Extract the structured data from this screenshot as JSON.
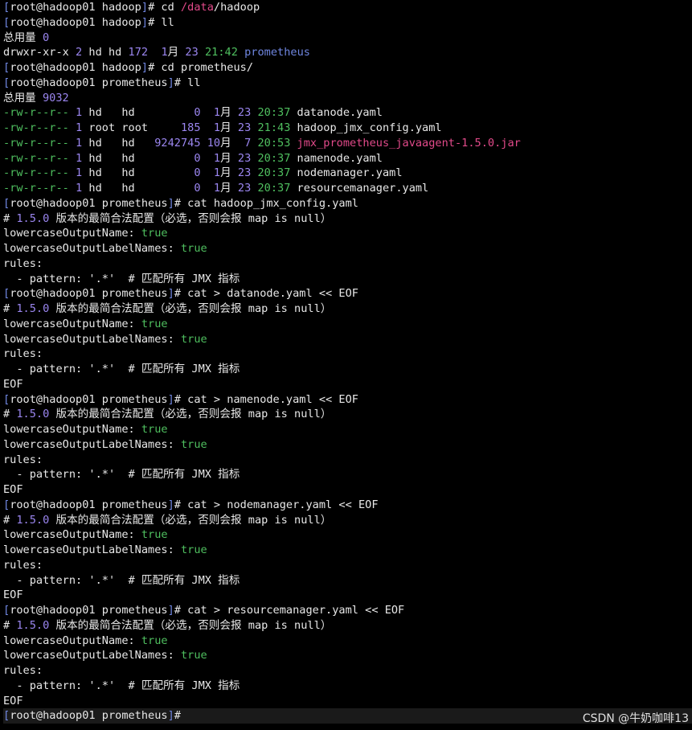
{
  "terminal": {
    "prompt_user_host": "root@hadoop01",
    "lines": [
      [
        {
          "t": "[",
          "c": "bracket"
        },
        {
          "t": "root@hadoop01 hadoop",
          "c": "c-white"
        },
        {
          "t": "]",
          "c": "bracket"
        },
        {
          "t": "# cd ",
          "c": "c-white"
        },
        {
          "t": "/data",
          "c": "c-red"
        },
        {
          "t": "/hadoop",
          "c": "c-white"
        }
      ],
      [
        {
          "t": "[",
          "c": "bracket"
        },
        {
          "t": "root@hadoop01 hadoop",
          "c": "c-white"
        },
        {
          "t": "]",
          "c": "bracket"
        },
        {
          "t": "# ll",
          "c": "c-white"
        }
      ],
      [
        {
          "t": "总用量 ",
          "c": "c-white"
        },
        {
          "t": "0",
          "c": "c-purple"
        }
      ],
      [
        {
          "t": "drwxr-xr-x ",
          "c": "c-white"
        },
        {
          "t": "2",
          "c": "c-purple"
        },
        {
          "t": " hd hd ",
          "c": "c-white"
        },
        {
          "t": "172",
          "c": "c-purple"
        },
        {
          "t": "  ",
          "c": "c-white"
        },
        {
          "t": "1",
          "c": "c-purple"
        },
        {
          "t": "月 ",
          "c": "c-white"
        },
        {
          "t": "23",
          "c": "c-purple"
        },
        {
          "t": " ",
          "c": "c-white"
        },
        {
          "t": "21:42",
          "c": "c-green"
        },
        {
          "t": " prometheus",
          "c": "c-blue"
        }
      ],
      [
        {
          "t": "[",
          "c": "bracket"
        },
        {
          "t": "root@hadoop01 hadoop",
          "c": "c-white"
        },
        {
          "t": "]",
          "c": "bracket"
        },
        {
          "t": "# cd prometheus/",
          "c": "c-white"
        }
      ],
      [
        {
          "t": "[",
          "c": "bracket"
        },
        {
          "t": "root@hadoop01 prometheus",
          "c": "c-white"
        },
        {
          "t": "]",
          "c": "bracket"
        },
        {
          "t": "# ll",
          "c": "c-white"
        }
      ],
      [
        {
          "t": "总用量 ",
          "c": "c-white"
        },
        {
          "t": "9032",
          "c": "c-purple"
        }
      ],
      [
        {
          "t": "-rw-r--r-- ",
          "c": "c-green"
        },
        {
          "t": "1",
          "c": "c-purple"
        },
        {
          "t": " hd   hd         ",
          "c": "c-white"
        },
        {
          "t": "0",
          "c": "c-purple"
        },
        {
          "t": "  ",
          "c": "c-white"
        },
        {
          "t": "1",
          "c": "c-purple"
        },
        {
          "t": "月 ",
          "c": "c-white"
        },
        {
          "t": "23",
          "c": "c-purple"
        },
        {
          "t": " ",
          "c": "c-white"
        },
        {
          "t": "20:37",
          "c": "c-green"
        },
        {
          "t": " datanode.yaml",
          "c": "c-white"
        }
      ],
      [
        {
          "t": "-rw-r--r-- ",
          "c": "c-green"
        },
        {
          "t": "1",
          "c": "c-purple"
        },
        {
          "t": " root root     ",
          "c": "c-white"
        },
        {
          "t": "185",
          "c": "c-purple"
        },
        {
          "t": "  ",
          "c": "c-white"
        },
        {
          "t": "1",
          "c": "c-purple"
        },
        {
          "t": "月 ",
          "c": "c-white"
        },
        {
          "t": "23",
          "c": "c-purple"
        },
        {
          "t": " ",
          "c": "c-white"
        },
        {
          "t": "21:43",
          "c": "c-green"
        },
        {
          "t": " hadoop_jmx_config.yaml",
          "c": "c-white"
        }
      ],
      [
        {
          "t": "-rw-r--r-- ",
          "c": "c-green"
        },
        {
          "t": "1",
          "c": "c-purple"
        },
        {
          "t": " hd   hd   ",
          "c": "c-white"
        },
        {
          "t": "9242745",
          "c": "c-purple"
        },
        {
          "t": " ",
          "c": "c-white"
        },
        {
          "t": "10",
          "c": "c-purple"
        },
        {
          "t": "月  ",
          "c": "c-white"
        },
        {
          "t": "7",
          "c": "c-purple"
        },
        {
          "t": " ",
          "c": "c-white"
        },
        {
          "t": "20:53",
          "c": "c-green"
        },
        {
          "t": " jmx_prometheus_javaagent-1.5.0.jar",
          "c": "c-red"
        }
      ],
      [
        {
          "t": "-rw-r--r-- ",
          "c": "c-green"
        },
        {
          "t": "1",
          "c": "c-purple"
        },
        {
          "t": " hd   hd         ",
          "c": "c-white"
        },
        {
          "t": "0",
          "c": "c-purple"
        },
        {
          "t": "  ",
          "c": "c-white"
        },
        {
          "t": "1",
          "c": "c-purple"
        },
        {
          "t": "月 ",
          "c": "c-white"
        },
        {
          "t": "23",
          "c": "c-purple"
        },
        {
          "t": " ",
          "c": "c-white"
        },
        {
          "t": "20:37",
          "c": "c-green"
        },
        {
          "t": " namenode.yaml",
          "c": "c-white"
        }
      ],
      [
        {
          "t": "-rw-r--r-- ",
          "c": "c-green"
        },
        {
          "t": "1",
          "c": "c-purple"
        },
        {
          "t": " hd   hd         ",
          "c": "c-white"
        },
        {
          "t": "0",
          "c": "c-purple"
        },
        {
          "t": "  ",
          "c": "c-white"
        },
        {
          "t": "1",
          "c": "c-purple"
        },
        {
          "t": "月 ",
          "c": "c-white"
        },
        {
          "t": "23",
          "c": "c-purple"
        },
        {
          "t": " ",
          "c": "c-white"
        },
        {
          "t": "20:37",
          "c": "c-green"
        },
        {
          "t": " nodemanager.yaml",
          "c": "c-white"
        }
      ],
      [
        {
          "t": "-rw-r--r-- ",
          "c": "c-green"
        },
        {
          "t": "1",
          "c": "c-purple"
        },
        {
          "t": " hd   hd         ",
          "c": "c-white"
        },
        {
          "t": "0",
          "c": "c-purple"
        },
        {
          "t": "  ",
          "c": "c-white"
        },
        {
          "t": "1",
          "c": "c-purple"
        },
        {
          "t": "月 ",
          "c": "c-white"
        },
        {
          "t": "23",
          "c": "c-purple"
        },
        {
          "t": " ",
          "c": "c-white"
        },
        {
          "t": "20:37",
          "c": "c-green"
        },
        {
          "t": " resourcemanager.yaml",
          "c": "c-white"
        }
      ],
      [
        {
          "t": "[",
          "c": "bracket"
        },
        {
          "t": "root@hadoop01 prometheus",
          "c": "c-white"
        },
        {
          "t": "]",
          "c": "bracket"
        },
        {
          "t": "# cat hadoop_jmx_config.yaml",
          "c": "c-white"
        }
      ],
      [
        {
          "t": "# ",
          "c": "c-white"
        },
        {
          "t": "1.5.0",
          "c": "c-purple"
        },
        {
          "t": " 版本的最简合法配置（必选，否则会报 map is null）",
          "c": "c-white"
        }
      ],
      [
        {
          "t": "lowercaseOutputName",
          "c": "c-white"
        },
        {
          "t": ": ",
          "c": "c-white"
        },
        {
          "t": "true",
          "c": "c-green"
        }
      ],
      [
        {
          "t": "lowercaseOutputLabelNames",
          "c": "c-white"
        },
        {
          "t": ": ",
          "c": "c-white"
        },
        {
          "t": "true",
          "c": "c-green"
        }
      ],
      [
        {
          "t": "rules:",
          "c": "c-white"
        }
      ],
      [
        {
          "t": "  - pattern: '.*'  # 匹配所有 JMX 指标",
          "c": "c-white"
        }
      ],
      [
        {
          "t": "[",
          "c": "bracket"
        },
        {
          "t": "root@hadoop01 prometheus",
          "c": "c-white"
        },
        {
          "t": "]",
          "c": "bracket"
        },
        {
          "t": "# cat > datanode.yaml << EOF",
          "c": "c-white"
        }
      ],
      [
        {
          "t": "# ",
          "c": "c-white"
        },
        {
          "t": "1.5.0",
          "c": "c-purple"
        },
        {
          "t": " 版本的最简合法配置（必选，否则会报 map is null）",
          "c": "c-white"
        }
      ],
      [
        {
          "t": "lowercaseOutputName",
          "c": "c-white"
        },
        {
          "t": ": ",
          "c": "c-white"
        },
        {
          "t": "true",
          "c": "c-green"
        }
      ],
      [
        {
          "t": "lowercaseOutputLabelNames",
          "c": "c-white"
        },
        {
          "t": ": ",
          "c": "c-white"
        },
        {
          "t": "true",
          "c": "c-green"
        }
      ],
      [
        {
          "t": "rules:",
          "c": "c-white"
        }
      ],
      [
        {
          "t": "  - pattern: '.*'  # 匹配所有 JMX 指标",
          "c": "c-white"
        }
      ],
      [
        {
          "t": "EOF",
          "c": "c-white"
        }
      ],
      [
        {
          "t": "[",
          "c": "bracket"
        },
        {
          "t": "root@hadoop01 prometheus",
          "c": "c-white"
        },
        {
          "t": "]",
          "c": "bracket"
        },
        {
          "t": "# cat > namenode.yaml << EOF",
          "c": "c-white"
        }
      ],
      [
        {
          "t": "# ",
          "c": "c-white"
        },
        {
          "t": "1.5.0",
          "c": "c-purple"
        },
        {
          "t": " 版本的最简合法配置（必选，否则会报 map is null）",
          "c": "c-white"
        }
      ],
      [
        {
          "t": "lowercaseOutputName",
          "c": "c-white"
        },
        {
          "t": ": ",
          "c": "c-white"
        },
        {
          "t": "true",
          "c": "c-green"
        }
      ],
      [
        {
          "t": "lowercaseOutputLabelNames",
          "c": "c-white"
        },
        {
          "t": ": ",
          "c": "c-white"
        },
        {
          "t": "true",
          "c": "c-green"
        }
      ],
      [
        {
          "t": "rules:",
          "c": "c-white"
        }
      ],
      [
        {
          "t": "  - pattern: '.*'  # 匹配所有 JMX 指标",
          "c": "c-white"
        }
      ],
      [
        {
          "t": "EOF",
          "c": "c-white"
        }
      ],
      [
        {
          "t": "[",
          "c": "bracket"
        },
        {
          "t": "root@hadoop01 prometheus",
          "c": "c-white"
        },
        {
          "t": "]",
          "c": "bracket"
        },
        {
          "t": "# cat > nodemanager.yaml << EOF",
          "c": "c-white"
        }
      ],
      [
        {
          "t": "# ",
          "c": "c-white"
        },
        {
          "t": "1.5.0",
          "c": "c-purple"
        },
        {
          "t": " 版本的最简合法配置（必选，否则会报 map is null）",
          "c": "c-white"
        }
      ],
      [
        {
          "t": "lowercaseOutputName",
          "c": "c-white"
        },
        {
          "t": ": ",
          "c": "c-white"
        },
        {
          "t": "true",
          "c": "c-green"
        }
      ],
      [
        {
          "t": "lowercaseOutputLabelNames",
          "c": "c-white"
        },
        {
          "t": ": ",
          "c": "c-white"
        },
        {
          "t": "true",
          "c": "c-green"
        }
      ],
      [
        {
          "t": "rules:",
          "c": "c-white"
        }
      ],
      [
        {
          "t": "  - pattern: '.*'  # 匹配所有 JMX 指标",
          "c": "c-white"
        }
      ],
      [
        {
          "t": "EOF",
          "c": "c-white"
        }
      ],
      [
        {
          "t": "[",
          "c": "bracket"
        },
        {
          "t": "root@hadoop01 prometheus",
          "c": "c-white"
        },
        {
          "t": "]",
          "c": "bracket"
        },
        {
          "t": "# cat > resourcemanager.yaml << EOF",
          "c": "c-white"
        }
      ],
      [
        {
          "t": "# ",
          "c": "c-white"
        },
        {
          "t": "1.5.0",
          "c": "c-purple"
        },
        {
          "t": " 版本的最简合法配置（必选，否则会报 map is null）",
          "c": "c-white"
        }
      ],
      [
        {
          "t": "lowercaseOutputName",
          "c": "c-white"
        },
        {
          "t": ": ",
          "c": "c-white"
        },
        {
          "t": "true",
          "c": "c-green"
        }
      ],
      [
        {
          "t": "lowercaseOutputLabelNames",
          "c": "c-white"
        },
        {
          "t": ": ",
          "c": "c-white"
        },
        {
          "t": "true",
          "c": "c-green"
        }
      ],
      [
        {
          "t": "rules:",
          "c": "c-white"
        }
      ],
      [
        {
          "t": "  - pattern: '.*'  # 匹配所有 JMX 指标",
          "c": "c-white"
        }
      ],
      [
        {
          "t": "EOF",
          "c": "c-white"
        }
      ],
      [
        {
          "t": "[",
          "c": "bracket"
        },
        {
          "t": "root@hadoop01 prometheus",
          "c": "c-white"
        },
        {
          "t": "]",
          "c": "bracket"
        },
        {
          "t": "#",
          "c": "c-white"
        }
      ]
    ]
  },
  "watermark": "CSDN @牛奶咖啡13",
  "colors": {
    "background": "#000000",
    "text": "#e8e8e8",
    "bracket": "#6f86e0",
    "number": "#9b86f0",
    "green": "#4fbf5f",
    "red": "#e24a8a"
  }
}
